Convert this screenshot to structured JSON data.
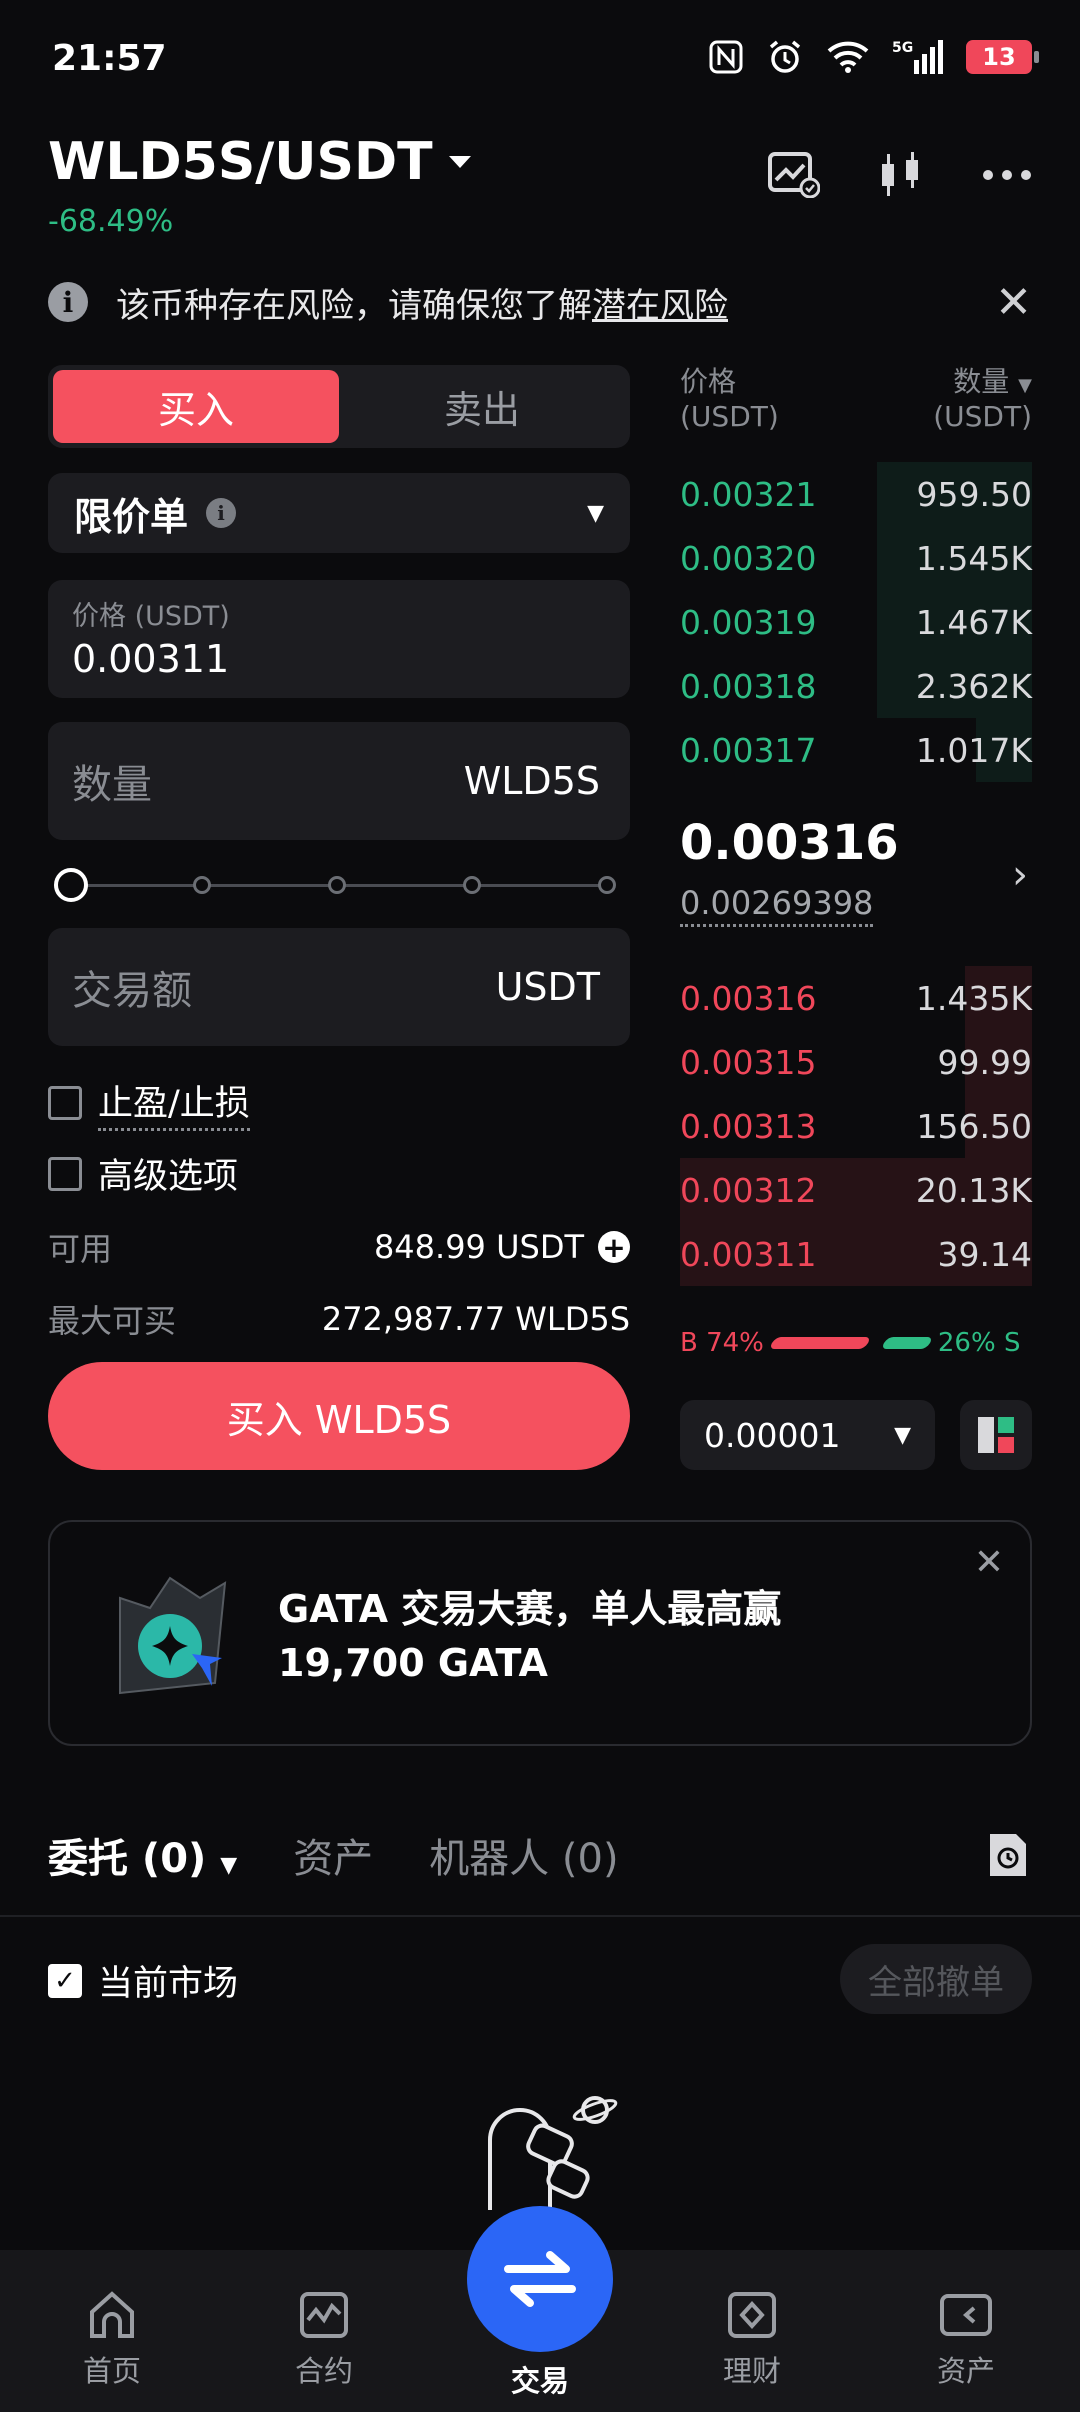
{
  "status_bar": {
    "time": "21:57",
    "battery": "13",
    "network": "5G"
  },
  "header": {
    "pair": "WLD5S/USDT",
    "change": "-68.49%"
  },
  "risk_banner": {
    "text": "该币种存在风险，请确保您了解",
    "link": "潜在风险"
  },
  "trade_form": {
    "tab_buy": "买入",
    "tab_sell": "卖出",
    "order_type": "限价单",
    "price_label": "价格 (USDT)",
    "price_value": "0.00311",
    "amount_label": "数量",
    "amount_unit": "WLD5S",
    "total_label": "交易额",
    "total_unit": "USDT",
    "tpsl_label": "止盈/止损",
    "advanced_label": "高级选项",
    "available_label": "可用",
    "available_value": "848.99 USDT",
    "max_buy_label": "最大可买",
    "max_buy_value": "272,987.77 WLD5S",
    "buy_button": "买入 WLD5S"
  },
  "order_book": {
    "col_price": "价格",
    "col_price_unit": "(USDT)",
    "col_qty": "数量",
    "col_qty_unit": "(USDT)",
    "asks": [
      {
        "price": "0.00321",
        "qty": "959.50",
        "depth": 0.44
      },
      {
        "price": "0.00320",
        "qty": "1.545K",
        "depth": 0.44
      },
      {
        "price": "0.00319",
        "qty": "1.467K",
        "depth": 0.44
      },
      {
        "price": "0.00318",
        "qty": "2.362K",
        "depth": 0.44
      },
      {
        "price": "0.00317",
        "qty": "1.017K",
        "depth": 0.16
      }
    ],
    "last_price": "0.00316",
    "mark_price": "0.00269398",
    "bids": [
      {
        "price": "0.00316",
        "qty": "1.435K",
        "depth": 0.19
      },
      {
        "price": "0.00315",
        "qty": "99.99",
        "depth": 0.19
      },
      {
        "price": "0.00313",
        "qty": "156.50",
        "depth": 0.19
      },
      {
        "price": "0.00312",
        "qty": "20.13K",
        "depth": 1.0
      },
      {
        "price": "0.00311",
        "qty": "39.14",
        "depth": 1.0
      }
    ],
    "buy_ratio": "B 74%",
    "sell_ratio": "26% S",
    "buy_fraction": 0.74,
    "precision": "0.00001"
  },
  "promo": {
    "line1": "GATA 交易大赛，单人最高赢",
    "line2": "19,700 GATA"
  },
  "orders_section": {
    "tab_orders": "委托 (0)",
    "tab_assets": "资产",
    "tab_bots": "机器人 (0)",
    "current_market": "当前市场",
    "cancel_all": "全部撤单"
  },
  "bottom_nav": {
    "home": "首页",
    "futures": "合约",
    "trade": "交易",
    "finance": "理财",
    "assets": "资产"
  },
  "colors": {
    "buy": "#f5515f",
    "green": "#2ebd85",
    "red": "#f0475a",
    "fab": "#2b66f6"
  }
}
